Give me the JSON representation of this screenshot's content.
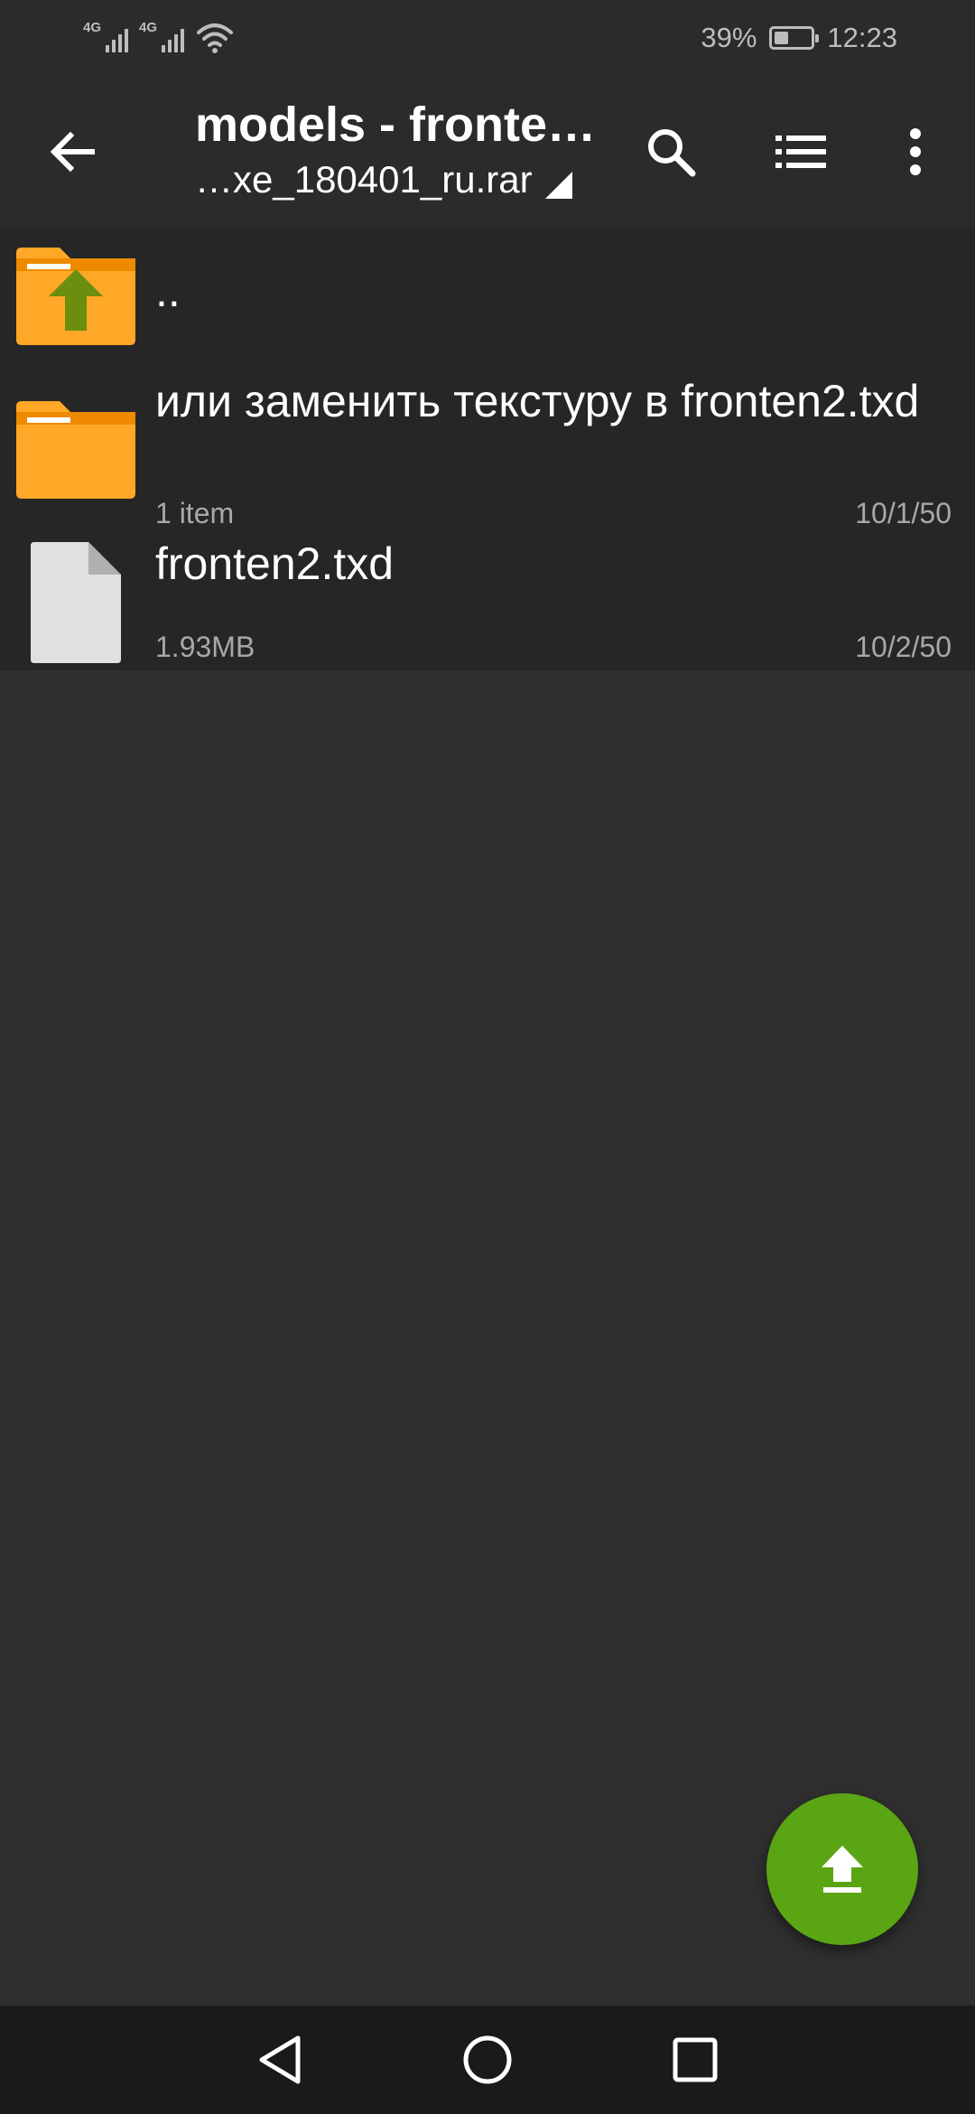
{
  "status_bar": {
    "signal1_label": "4G",
    "signal2_label": "4G",
    "battery_percent": "39%",
    "battery_level": 0.39,
    "time": "12:23"
  },
  "toolbar": {
    "title": "models - fronte…",
    "subtitle": "…xe_180401_ru.rar"
  },
  "list": {
    "items": [
      {
        "name": "..",
        "meta": "",
        "date": "",
        "icon": "folder-up-icon"
      },
      {
        "name": "или заменить текстуру в fronten2.txd",
        "meta": "1 item",
        "date": "10/1/50",
        "icon": "folder-icon"
      },
      {
        "name": "fronten2.txd",
        "meta": "1.93MB",
        "date": "10/2/50",
        "icon": "file-icon"
      }
    ]
  },
  "fab": {
    "icon": "upload-icon"
  },
  "colors": {
    "accent": "#5aa514",
    "folder": "#ffa726",
    "background": "#2f2f2f",
    "list_background": "#262626"
  }
}
